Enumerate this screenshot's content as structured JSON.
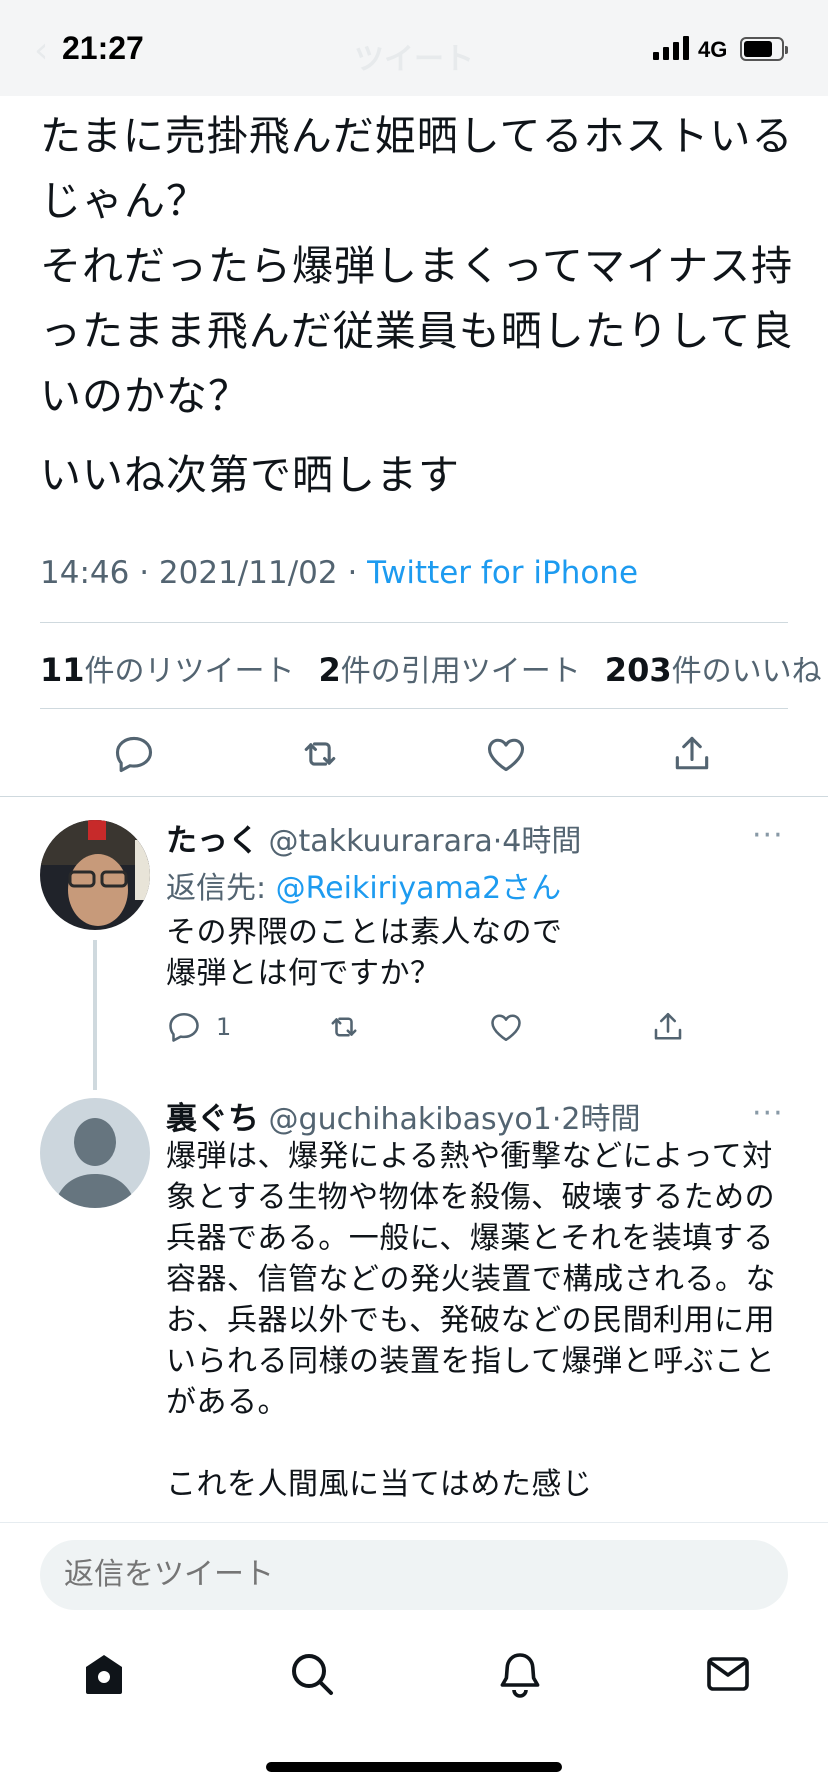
{
  "status_bar": {
    "time": "21:27",
    "network": "4G",
    "nav_title": "ツイート"
  },
  "tweet": {
    "text": "たまに売掛飛んだ姫晒してるホストいるじゃん？\nそれだったら爆弾しまくってマイナス持ったまま飛んだ従業員も晒したりして良いのかな？",
    "text2": "いいね次第で晒します",
    "time": "14:46",
    "sep1": " · ",
    "date": "2021/11/02",
    "sep2": " · ",
    "source": "Twitter for iPhone",
    "stats": {
      "retweets_count": "11",
      "retweets_label": "件のリツイート",
      "quotes_count": "2",
      "quotes_label": "件の引用ツイート",
      "likes_count": "203",
      "likes_label": "件のいいね"
    }
  },
  "replies": [
    {
      "name": "たっく",
      "handle": "@takkuurarara",
      "dot": "·",
      "time": "4時間",
      "reply_to_label": "返信先: ",
      "reply_to_user": "@Reikiriyama2さん",
      "text": "その界隈のことは素人なので\n爆弾とは何ですか？",
      "reply_count": "1",
      "more": "···"
    },
    {
      "name": "裏ぐち",
      "handle": "@guchihakibasyo1",
      "dot": "·",
      "time": "2時間",
      "text": "爆弾は、爆発による熱や衝撃などによって対象とする生物や物体を殺傷、破壊するための兵器である。一般に、爆薬とそれを装填する容器、信管などの発火装置で構成される。なお、兵器以外でも、発破などの民間利用に用いられる同様の装置を指して爆弾と呼ぶことがある。\n\nこれを人間風に当てはめた感じ",
      "more": "···"
    }
  ],
  "reply_input": {
    "placeholder": "返信をツイート"
  },
  "colors": {
    "link": "#1d9bf0",
    "secondary_text": "#536471",
    "icon": "#536471"
  }
}
